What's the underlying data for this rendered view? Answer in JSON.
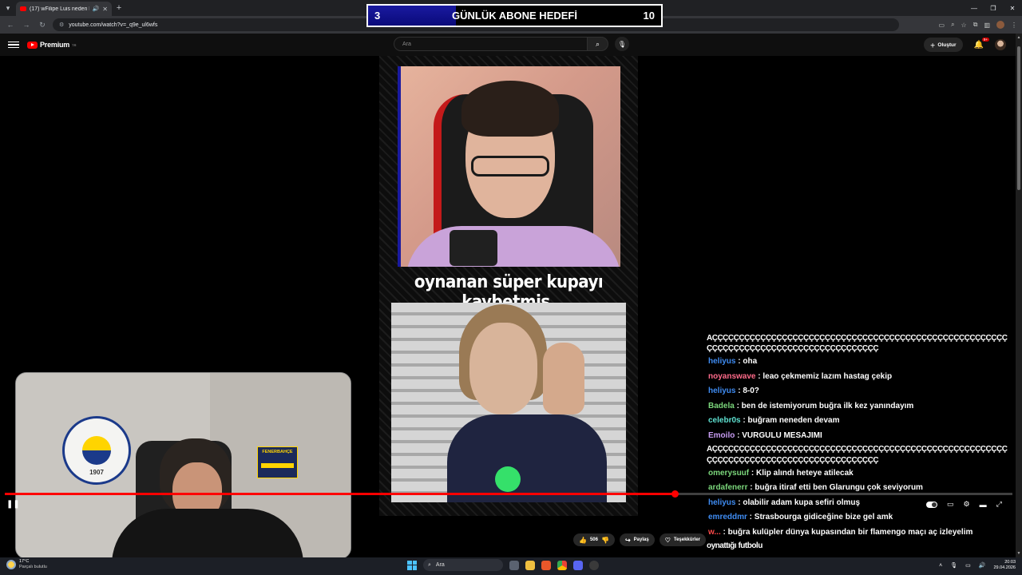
{
  "browser": {
    "tab_title": "(17) wFilipe Luis neden kov",
    "url": "youtube.com/watch?v=_q9e_ul6wfs"
  },
  "youtube": {
    "logo_text": "Premium",
    "logo_sup": "TR",
    "search_placeholder": "Ara",
    "create_label": "Oluştur",
    "notification_count": "9+"
  },
  "goal_overlay": {
    "current": "3",
    "title": "GÜNLÜK ABONE HEDEFİ",
    "target": "10",
    "progress_fraction": 0.3
  },
  "video": {
    "caption": "oynanan süper kupayı kaybetmiş.",
    "played_fraction": 0.665
  },
  "webcam": {
    "crest_year": "1907",
    "sign_text": "FENERBAHÇE"
  },
  "chat": {
    "messages": [
      {
        "spam": "AÇÇÇÇÇÇÇÇÇÇÇÇÇÇÇÇÇÇÇÇÇÇÇÇÇÇÇÇÇÇÇÇÇÇÇÇÇÇÇÇÇÇÇÇÇÇÇÇÇÇÇÇÇÇÇ",
        "cls": "first"
      },
      {
        "spam": "ÇÇÇÇÇÇÇÇÇÇÇÇÇÇÇÇÇÇÇÇÇÇÇÇÇÇÇÇÇÇÇÇ"
      },
      {
        "user": "heliyus",
        "color": "#3f8cf2",
        "text": ": oha"
      },
      {
        "user": "noyanswave",
        "color": "#ff6b8a",
        "text": ": leao çekmemiz lazım hastag çekip"
      },
      {
        "user": "heliyus",
        "color": "#3f8cf2",
        "text": ": 8-0?"
      },
      {
        "user": "Badela",
        "color": "#7bd67b",
        "text": ": ben de istemiyorum buğra ilk kez yanındayım"
      },
      {
        "user": "celebr0s",
        "color": "#5ee0d0",
        "text": ": buğram neneden devam"
      },
      {
        "user": "Emoilo",
        "color": "#c79cf2",
        "text": ": VURGULU MESAJIMI"
      },
      {
        "spam": "AÇÇÇÇÇÇÇÇÇÇÇÇÇÇÇÇÇÇÇÇÇÇÇÇÇÇÇÇÇÇÇÇÇÇÇÇÇÇÇÇÇÇÇÇÇÇÇÇÇÇÇÇÇÇÇ"
      },
      {
        "spam": "ÇÇÇÇÇÇÇÇÇÇÇÇÇÇÇÇÇÇÇÇÇÇÇÇÇÇÇÇÇÇÇÇ"
      },
      {
        "user": "omerysuuf",
        "color": "#7bd67b",
        "text": ": Klip alındı heteye atilecak"
      },
      {
        "user": "ardafenerr",
        "color": "#7bd67b",
        "text": ": buğra itiraf etti ben Glarungu çok seviyorum"
      },
      {
        "user": "heliyus",
        "color": "#3f8cf2",
        "text": ": olabilir adam kupa sefiri olmuş"
      },
      {
        "user": "emreddmr",
        "color": "#3f8cf2",
        "text": ": Strasbourga gidiceğine bize gel amk"
      },
      {
        "user": "w...",
        "color": "#ff4a4a",
        "text": ": buğra kulüpler dünya kupasından bir flamengo maçı aç izleyelim"
      },
      {
        "spam": "oynattığı futbolu"
      }
    ]
  },
  "action_bar": {
    "likes": "506",
    "share": "Paylaş",
    "thanks": "Teşekkürler"
  },
  "taskbar": {
    "temp": "17°C",
    "weather": "Parçalı bulutlu",
    "search": "Ara",
    "time": "20:03",
    "date": "29.04.2026"
  },
  "colors": {
    "accent_red": "#ff0000",
    "goal_fill": "#1a1aa0"
  }
}
